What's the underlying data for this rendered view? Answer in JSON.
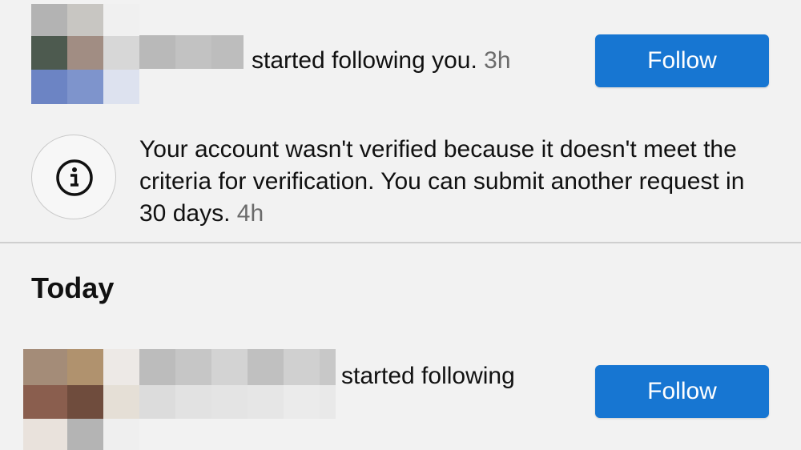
{
  "notifications": [
    {
      "text": "started following you.",
      "time": "3h",
      "button_label": "Follow"
    },
    {
      "text": "Your account wasn't verified because it doesn't meet the criteria for verification. You can submit another request in 30 days.",
      "time": "4h",
      "icon": "info-icon"
    }
  ],
  "today": {
    "title": "Today",
    "notifications": [
      {
        "text": "started following",
        "button_label": "Follow"
      }
    ]
  },
  "colors": {
    "background": "#f2f2f2",
    "follow_button": "#1776d2",
    "timestamp": "#6b6b6b",
    "divider": "#cfcfcf"
  }
}
